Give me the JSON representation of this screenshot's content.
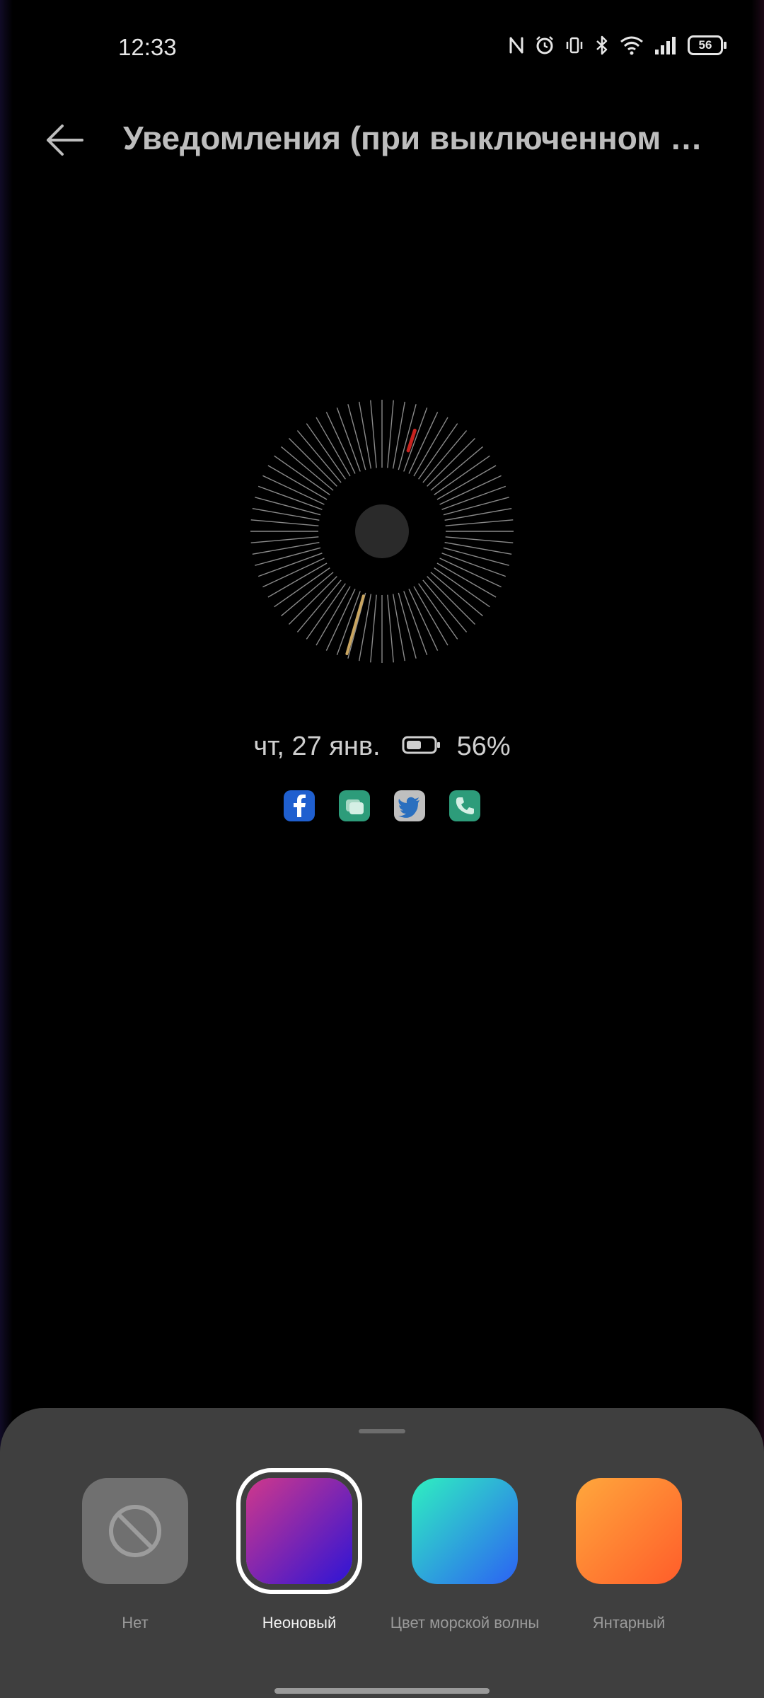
{
  "status_bar": {
    "time": "12:33",
    "icons": [
      "nfc-icon",
      "alarm-icon",
      "vibrate-icon",
      "bluetooth-icon",
      "wifi-icon",
      "signal-icon"
    ],
    "battery_level": "56"
  },
  "header": {
    "back_icon": "arrow-left-icon",
    "title": "Уведомления (при выключенном экране)"
  },
  "preview": {
    "date": "чт, 27 янв.",
    "battery_percent": "56%",
    "notification_icons": [
      "facebook-icon",
      "messages-icon",
      "twitter-icon",
      "phone-icon"
    ],
    "notification_colors": [
      "#1f5fcf",
      "#2d9c7a",
      "#bfbfbf",
      "#2d9c7a"
    ],
    "hand_colors": {
      "minute": "#c8231f",
      "hour": "#c9a560"
    }
  },
  "color_options": [
    {
      "label": "Нет",
      "colors": [
        "#707070",
        "#707070"
      ],
      "selected": false
    },
    {
      "label": "Неоновый",
      "colors": [
        "#d0388b",
        "#2e14d6"
      ],
      "selected": true
    },
    {
      "label": "Цвет морской волны",
      "colors": [
        "#2ff0c0",
        "#2c62f3"
      ],
      "selected": false
    },
    {
      "label": "Янтарный",
      "colors": [
        "#ffa73c",
        "#ff5d2a"
      ],
      "selected": false
    }
  ]
}
